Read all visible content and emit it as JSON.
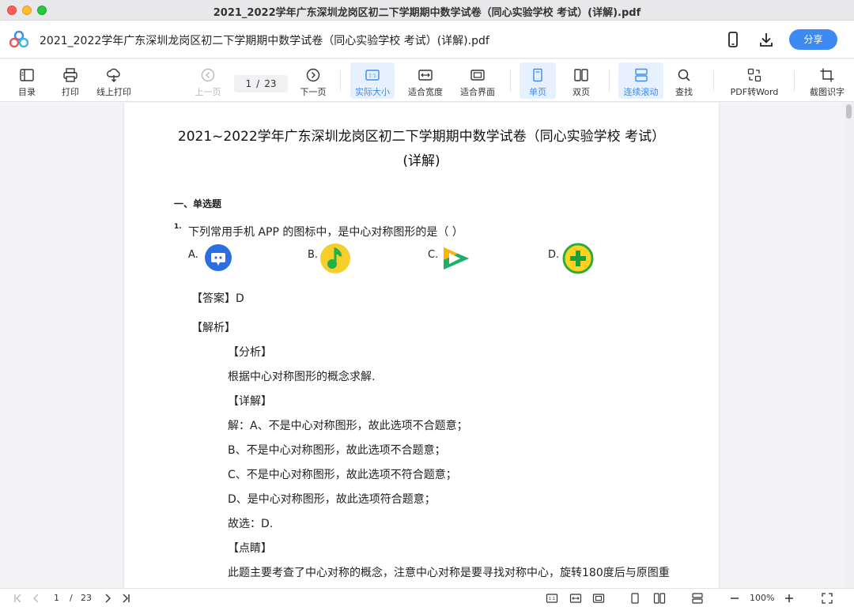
{
  "window": {
    "title": "2021_2022学年广东深圳龙岗区初二下学期期中数学试卷（同心实验学校 考试）(详解).pdf"
  },
  "header": {
    "doc_title": "2021_2022学年广东深圳龙岗区初二下学期期中数学试卷（同心实验学校 考试）(详解).pdf",
    "share_label": "分享"
  },
  "toolbar": {
    "toc": "目录",
    "print": "打印",
    "online_print": "线上打印",
    "prev_page": "上一页",
    "current_page": "1",
    "page_sep": "/",
    "total_pages": "23",
    "next_page": "下一页",
    "actual_size": "实际大小",
    "fit_width": "适合宽度",
    "fit_window": "适合界面",
    "single_page": "单页",
    "double_page": "双页",
    "continuous_scroll": "连续滚动",
    "search": "查找",
    "pdf_to_word": "PDF转Word",
    "screenshot_ocr": "截图识字"
  },
  "document": {
    "title_line1": "2021~2022学年广东深圳龙岗区初二下学期期中数学试卷（同心实验学校 考试）",
    "title_line2": "(详解)",
    "section": "一、单选题",
    "question_number": "1.",
    "question": "下列常用手机 APP 的图标中，是中心对称图形的是（              ）",
    "options": [
      "A.",
      "B.",
      "C.",
      "D."
    ],
    "answer": "【答案】D",
    "analysis_heading": "【解析】",
    "lines": [
      "【分析】",
      "根据中心对称图形的概念求解.",
      "【详解】",
      "解：A、不是中心对称图形，故此选项不合题意；",
      "B、不是中心对称图形，故此选项不合题意；",
      "C、不是中心对称图形，故此选项不符合题意；",
      "D、是中心对称图形，故此选项符合题意；",
      "故选：D.",
      "【点睛】",
      "此题主要考查了中心对称的概念，注意中心对称是要寻找对称中心，旋转180度后与原图重"
    ]
  },
  "bottombar": {
    "current_page": "1",
    "page_sep": "/",
    "total_pages": "23",
    "zoom": "100%"
  },
  "colors": {
    "accent": "#3d8bf2",
    "active_bg": "#e7f0fd"
  },
  "icons": {
    "option_a": "chat-bubble-app-icon",
    "option_b": "music-note-app-icon",
    "option_c": "video-play-app-icon",
    "option_d": "plus-cross-app-icon"
  }
}
